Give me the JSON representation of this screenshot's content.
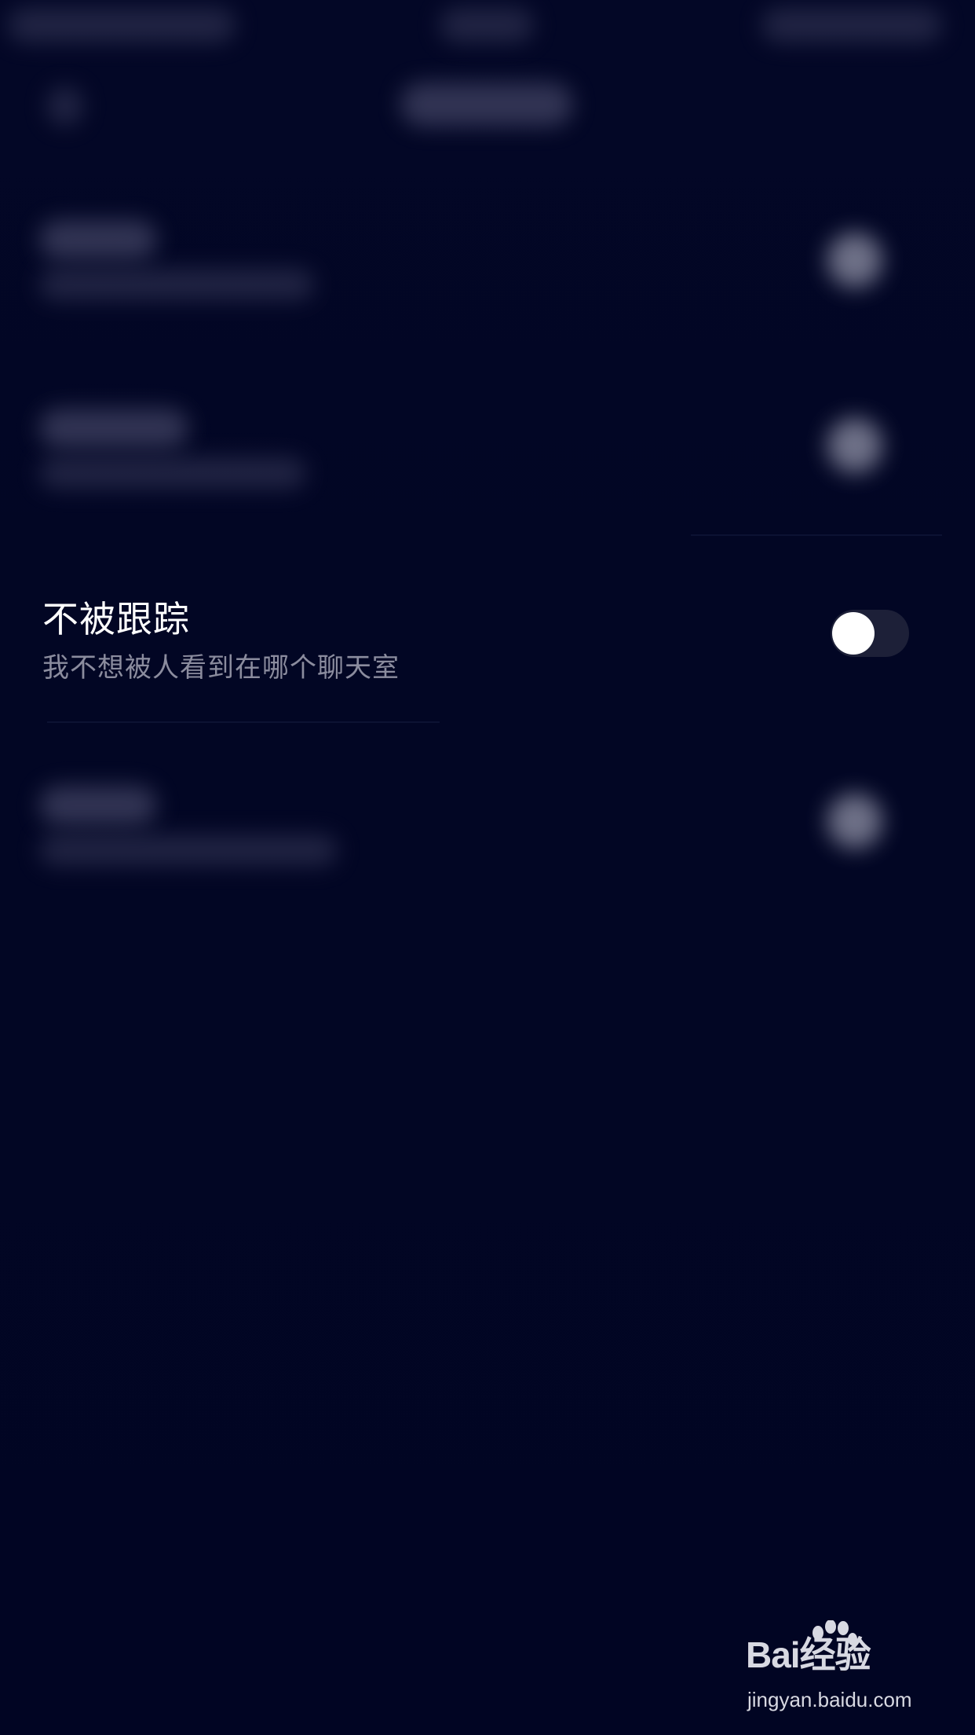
{
  "setting": {
    "title": "不被跟踪",
    "subtitle": "我不想被人看到在哪个聊天室",
    "toggle_on": false
  },
  "watermark": {
    "logo": "Bai经验",
    "url": "jingyan.baidu.com"
  },
  "colors": {
    "background": "#020623",
    "title_text": "#ffffff",
    "subtitle_text": "#8b8c9e",
    "toggle_track": "#1d2038",
    "toggle_knob": "#ffffff"
  }
}
